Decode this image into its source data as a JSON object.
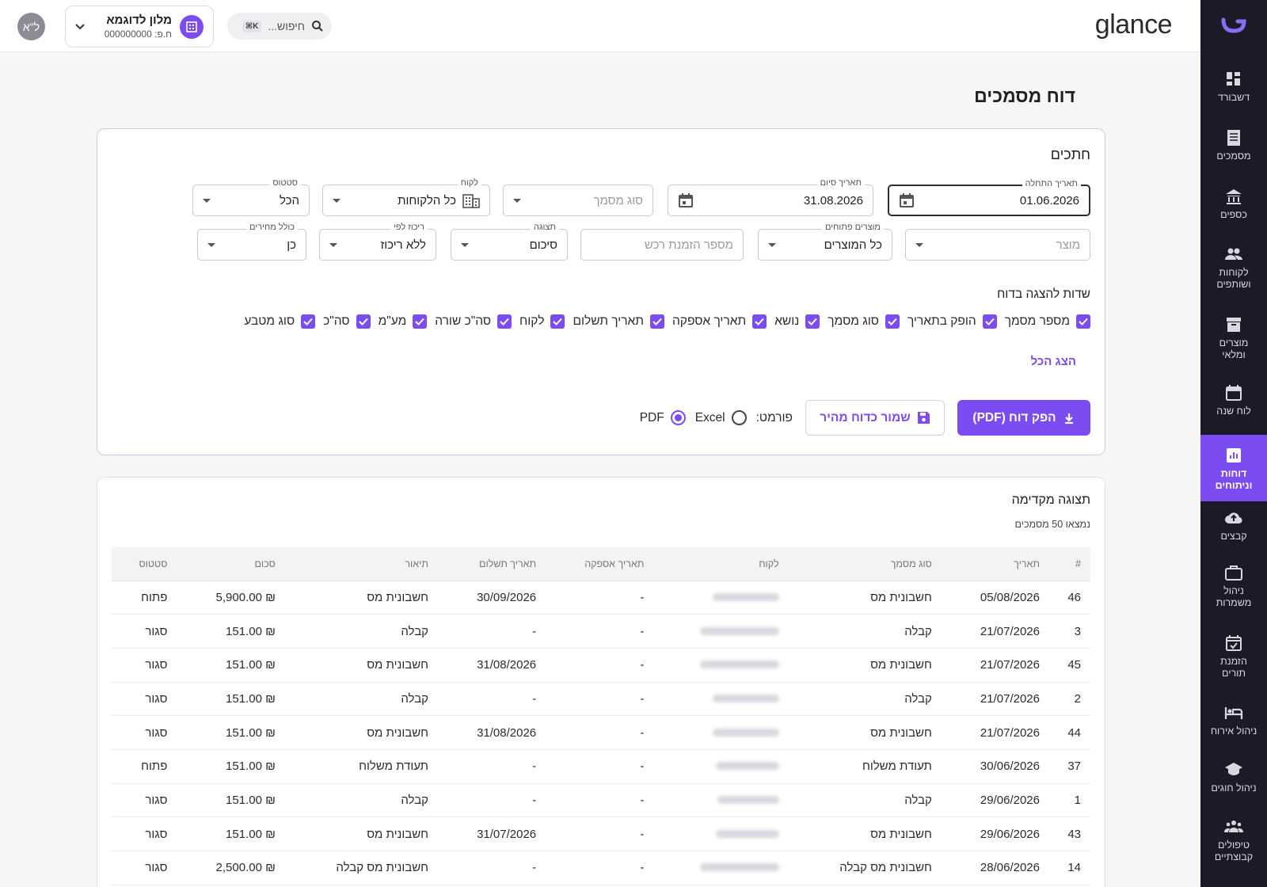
{
  "topbar": {
    "brand": "glance",
    "search_placeholder": "חיפוש...",
    "search_shortcut": "K⌘",
    "org_name": "מלון לדוגמא",
    "org_id": "ח.פ: 000000000",
    "user_initials": "ל\"א"
  },
  "sidebar": {
    "items": [
      {
        "label": "דשבורד",
        "icon": "dashboard-icon"
      },
      {
        "label": "מסמכים",
        "icon": "document-icon"
      },
      {
        "label": "כספים",
        "icon": "bank-icon"
      },
      {
        "label": "לקוחות\nושותפים",
        "icon": "people-icon"
      },
      {
        "label": "מוצרים\nומלאי",
        "icon": "archive-icon"
      },
      {
        "label": "לוח שנה",
        "icon": "calendar-icon"
      },
      {
        "label": "דוחות\nוניתוחים",
        "icon": "chart-icon"
      },
      {
        "label": "קבצים",
        "icon": "cloud-upload-icon"
      },
      {
        "label": "ניהול\nמשמרות",
        "icon": "briefcase-icon"
      },
      {
        "label": "הזמנת\nתורים",
        "icon": "calendar-check-icon"
      },
      {
        "label": "ניהול אירוח",
        "icon": "bed-icon"
      },
      {
        "label": "ניהול חוגים",
        "icon": "graduation-icon"
      },
      {
        "label": "טיפולים\nקבוצתיים",
        "icon": "groups-icon"
      }
    ]
  },
  "page": {
    "title": "דוח מסמכים"
  },
  "filters": {
    "title": "חתכים",
    "start_date": {
      "label": "תאריך התחלה",
      "value": "01.06.2026"
    },
    "end_date": {
      "label": "תאריך סיום",
      "value": "31.08.2026"
    },
    "doc_type": {
      "placeholder": "סוג מסמך"
    },
    "customer": {
      "label": "לקוח",
      "value": "כל הלקוחות"
    },
    "status": {
      "label": "סטטוס",
      "value": "הכל"
    },
    "product": {
      "placeholder": "מוצר"
    },
    "open_products": {
      "label": "מוצרים פתוחים",
      "value": "כל המוצרים"
    },
    "po_number": {
      "placeholder": "מספר הזמנת רכש"
    },
    "display": {
      "label": "תצוגה",
      "value": "סיכום"
    },
    "group_by": {
      "label": "ריכוז לפי",
      "value": "ללא ריכוז"
    },
    "include_prices": {
      "label": "כולל מחירים",
      "value": "כן"
    },
    "fields_label": "שדות להצגה בדוח",
    "fields": [
      "מספר מסמך",
      "הופק בתאריך",
      "סוג מסמך",
      "נושא",
      "תאריך אספקה",
      "תאריך תשלום",
      "לקוח",
      "סה\"כ שורה",
      "מע\"מ",
      "סה\"כ",
      "סוג מטבע"
    ],
    "show_all": "הצג הכל",
    "produce_button": "הפק דוח (PDF)",
    "save_button": "שמור כדוח מהיר",
    "format_label": "פורמט:",
    "format_excel": "Excel",
    "format_pdf": "PDF",
    "selected_format": "PDF"
  },
  "preview": {
    "title": "תצוגה מקדימה",
    "count": "נמצאו 50 מסמכים",
    "columns": [
      "#",
      "תאריך",
      "סוג מסמך",
      "לקוח",
      "תאריך אספקה",
      "תאריך תשלום",
      "תיאור",
      "סכום",
      "סטטוס"
    ],
    "rows": [
      [
        "46",
        "05/08/2026",
        "חשבונית מס",
        "",
        "-",
        "30/09/2026",
        "חשבונית מס",
        "₪ 5,900.00",
        "פתוח"
      ],
      [
        "3",
        "21/07/2026",
        "קבלה",
        "",
        "-",
        "-",
        "קבלה",
        "₪ 151.00",
        "סגור"
      ],
      [
        "45",
        "21/07/2026",
        "חשבונית מס",
        "",
        "-",
        "31/08/2026",
        "חשבונית מס",
        "₪ 151.00",
        "סגור"
      ],
      [
        "2",
        "21/07/2026",
        "קבלה",
        "",
        "-",
        "-",
        "קבלה",
        "₪ 151.00",
        "סגור"
      ],
      [
        "44",
        "21/07/2026",
        "חשבונית מס",
        "",
        "-",
        "31/08/2026",
        "חשבונית מס",
        "₪ 151.00",
        "סגור"
      ],
      [
        "37",
        "30/06/2026",
        "תעודת משלוח",
        "",
        "-",
        "-",
        "תעודת משלוח",
        "₪ 151.00",
        "פתוח"
      ],
      [
        "1",
        "29/06/2026",
        "קבלה",
        "",
        "-",
        "-",
        "קבלה",
        "₪ 151.00",
        "סגור"
      ],
      [
        "43",
        "29/06/2026",
        "חשבונית מס",
        "",
        "-",
        "31/07/2026",
        "חשבונית מס",
        "₪ 151.00",
        "סגור"
      ],
      [
        "14",
        "28/06/2026",
        "חשבונית מס קבלה",
        "",
        "-",
        "-",
        "חשבונית מס קבלה",
        "₪ 2,500.00",
        "סגור"
      ]
    ]
  },
  "colors": {
    "accent": "#7b4cf2",
    "sidebar": "#1c1a26"
  }
}
